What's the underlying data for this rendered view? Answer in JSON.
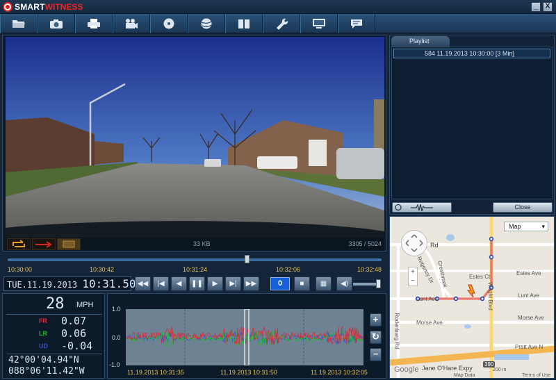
{
  "app": {
    "brand_smart": "SMART",
    "brand_witness": "WITNESS",
    "minimize": "_",
    "close": "X"
  },
  "toolbar": {
    "buttons": [
      {
        "icon": "folder-open-icon"
      },
      {
        "icon": "camera-icon"
      },
      {
        "icon": "printer-icon"
      },
      {
        "icon": "video-export-icon"
      },
      {
        "icon": "disc-icon"
      },
      {
        "icon": "globe-icon"
      },
      {
        "icon": "book-icon"
      },
      {
        "icon": "wrench-icon"
      },
      {
        "icon": "monitor-icon"
      },
      {
        "icon": "chat-icon"
      }
    ]
  },
  "video": {
    "file_size": "33 KB",
    "frame_counter": "3305 / 5024"
  },
  "playlist": {
    "tab_label": "Playlist",
    "items": [
      {
        "label": "584  11.19.2013 10:30:00 [3 Min]"
      }
    ],
    "close_label": "Close"
  },
  "map": {
    "view_select": "Map",
    "labels": {
      "rd": "Rd",
      "regency": "Regency Dr",
      "crestbrook": "Crestbrook",
      "estes_ct": "Estes Ct",
      "estes_ave": "Estes Ave",
      "lunt_left": "Lunt Ave",
      "lunt_right": "Lunt Ave",
      "morse_left": "Morse Ave",
      "morse_right": "Morse Ave",
      "wright": "Wright Blvd",
      "rodenburg": "Rodenburg Rd",
      "pratt": "Pratt Ave N",
      "expy": "Jane O'Hare Expy",
      "shield": "390",
      "google": "Google",
      "map_data": "Map Data",
      "scale": "200 m",
      "terms": "Terms of Use"
    },
    "zoom_in": "+",
    "zoom_out": "−"
  },
  "timeline": {
    "labels": [
      "10:30:00",
      "10:30:42",
      "10:31:24",
      "10:32:06",
      "10:32:48"
    ],
    "position": 0.64
  },
  "controls": {
    "date": "TUE.11.19.2013",
    "time": "10:31.50",
    "speed_value": "0",
    "volume_level": 0.9
  },
  "telemetry": {
    "speed": "28",
    "speed_unit": "MPH",
    "fr_label": "FR",
    "fr_value": "0.07",
    "lr_label": "LR",
    "lr_value": "0.06",
    "ud_label": "UD",
    "ud_value": "-0.04",
    "latitude": "42°00'04.94\"N",
    "longitude": "088°06'11.42\"W",
    "colors": {
      "fr": "#e0263a",
      "lr": "#1cbf2a",
      "ud": "#2a53e6"
    }
  },
  "graph": {
    "y_labels": [
      "1.0",
      "0.0",
      "-1.0"
    ],
    "x_labels": [
      "11.19.2013 10:31:35",
      "11.19.2013 10:31:50",
      "11.19.2013 10:32:05"
    ],
    "zoom_in": "+",
    "reset": "↻",
    "zoom_out": "−"
  }
}
